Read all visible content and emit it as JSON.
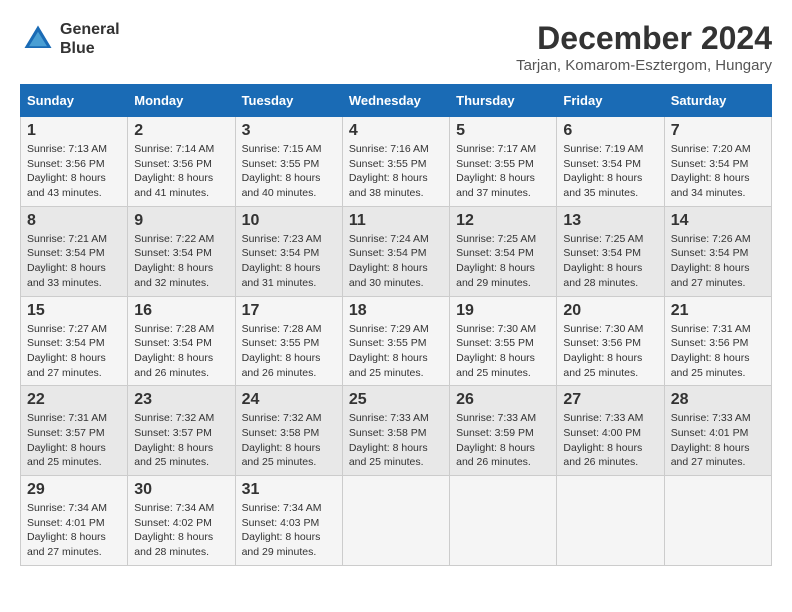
{
  "logo": {
    "line1": "General",
    "line2": "Blue"
  },
  "title": "December 2024",
  "subtitle": "Tarjan, Komarom-Esztergom, Hungary",
  "headers": [
    "Sunday",
    "Monday",
    "Tuesday",
    "Wednesday",
    "Thursday",
    "Friday",
    "Saturday"
  ],
  "weeks": [
    [
      {
        "day": "1",
        "sunrise": "Sunrise: 7:13 AM",
        "sunset": "Sunset: 3:56 PM",
        "daylight": "Daylight: 8 hours and 43 minutes."
      },
      {
        "day": "2",
        "sunrise": "Sunrise: 7:14 AM",
        "sunset": "Sunset: 3:56 PM",
        "daylight": "Daylight: 8 hours and 41 minutes."
      },
      {
        "day": "3",
        "sunrise": "Sunrise: 7:15 AM",
        "sunset": "Sunset: 3:55 PM",
        "daylight": "Daylight: 8 hours and 40 minutes."
      },
      {
        "day": "4",
        "sunrise": "Sunrise: 7:16 AM",
        "sunset": "Sunset: 3:55 PM",
        "daylight": "Daylight: 8 hours and 38 minutes."
      },
      {
        "day": "5",
        "sunrise": "Sunrise: 7:17 AM",
        "sunset": "Sunset: 3:55 PM",
        "daylight": "Daylight: 8 hours and 37 minutes."
      },
      {
        "day": "6",
        "sunrise": "Sunrise: 7:19 AM",
        "sunset": "Sunset: 3:54 PM",
        "daylight": "Daylight: 8 hours and 35 minutes."
      },
      {
        "day": "7",
        "sunrise": "Sunrise: 7:20 AM",
        "sunset": "Sunset: 3:54 PM",
        "daylight": "Daylight: 8 hours and 34 minutes."
      }
    ],
    [
      {
        "day": "8",
        "sunrise": "Sunrise: 7:21 AM",
        "sunset": "Sunset: 3:54 PM",
        "daylight": "Daylight: 8 hours and 33 minutes."
      },
      {
        "day": "9",
        "sunrise": "Sunrise: 7:22 AM",
        "sunset": "Sunset: 3:54 PM",
        "daylight": "Daylight: 8 hours and 32 minutes."
      },
      {
        "day": "10",
        "sunrise": "Sunrise: 7:23 AM",
        "sunset": "Sunset: 3:54 PM",
        "daylight": "Daylight: 8 hours and 31 minutes."
      },
      {
        "day": "11",
        "sunrise": "Sunrise: 7:24 AM",
        "sunset": "Sunset: 3:54 PM",
        "daylight": "Daylight: 8 hours and 30 minutes."
      },
      {
        "day": "12",
        "sunrise": "Sunrise: 7:25 AM",
        "sunset": "Sunset: 3:54 PM",
        "daylight": "Daylight: 8 hours and 29 minutes."
      },
      {
        "day": "13",
        "sunrise": "Sunrise: 7:25 AM",
        "sunset": "Sunset: 3:54 PM",
        "daylight": "Daylight: 8 hours and 28 minutes."
      },
      {
        "day": "14",
        "sunrise": "Sunrise: 7:26 AM",
        "sunset": "Sunset: 3:54 PM",
        "daylight": "Daylight: 8 hours and 27 minutes."
      }
    ],
    [
      {
        "day": "15",
        "sunrise": "Sunrise: 7:27 AM",
        "sunset": "Sunset: 3:54 PM",
        "daylight": "Daylight: 8 hours and 27 minutes."
      },
      {
        "day": "16",
        "sunrise": "Sunrise: 7:28 AM",
        "sunset": "Sunset: 3:54 PM",
        "daylight": "Daylight: 8 hours and 26 minutes."
      },
      {
        "day": "17",
        "sunrise": "Sunrise: 7:28 AM",
        "sunset": "Sunset: 3:55 PM",
        "daylight": "Daylight: 8 hours and 26 minutes."
      },
      {
        "day": "18",
        "sunrise": "Sunrise: 7:29 AM",
        "sunset": "Sunset: 3:55 PM",
        "daylight": "Daylight: 8 hours and 25 minutes."
      },
      {
        "day": "19",
        "sunrise": "Sunrise: 7:30 AM",
        "sunset": "Sunset: 3:55 PM",
        "daylight": "Daylight: 8 hours and 25 minutes."
      },
      {
        "day": "20",
        "sunrise": "Sunrise: 7:30 AM",
        "sunset": "Sunset: 3:56 PM",
        "daylight": "Daylight: 8 hours and 25 minutes."
      },
      {
        "day": "21",
        "sunrise": "Sunrise: 7:31 AM",
        "sunset": "Sunset: 3:56 PM",
        "daylight": "Daylight: 8 hours and 25 minutes."
      }
    ],
    [
      {
        "day": "22",
        "sunrise": "Sunrise: 7:31 AM",
        "sunset": "Sunset: 3:57 PM",
        "daylight": "Daylight: 8 hours and 25 minutes."
      },
      {
        "day": "23",
        "sunrise": "Sunrise: 7:32 AM",
        "sunset": "Sunset: 3:57 PM",
        "daylight": "Daylight: 8 hours and 25 minutes."
      },
      {
        "day": "24",
        "sunrise": "Sunrise: 7:32 AM",
        "sunset": "Sunset: 3:58 PM",
        "daylight": "Daylight: 8 hours and 25 minutes."
      },
      {
        "day": "25",
        "sunrise": "Sunrise: 7:33 AM",
        "sunset": "Sunset: 3:58 PM",
        "daylight": "Daylight: 8 hours and 25 minutes."
      },
      {
        "day": "26",
        "sunrise": "Sunrise: 7:33 AM",
        "sunset": "Sunset: 3:59 PM",
        "daylight": "Daylight: 8 hours and 26 minutes."
      },
      {
        "day": "27",
        "sunrise": "Sunrise: 7:33 AM",
        "sunset": "Sunset: 4:00 PM",
        "daylight": "Daylight: 8 hours and 26 minutes."
      },
      {
        "day": "28",
        "sunrise": "Sunrise: 7:33 AM",
        "sunset": "Sunset: 4:01 PM",
        "daylight": "Daylight: 8 hours and 27 minutes."
      }
    ],
    [
      {
        "day": "29",
        "sunrise": "Sunrise: 7:34 AM",
        "sunset": "Sunset: 4:01 PM",
        "daylight": "Daylight: 8 hours and 27 minutes."
      },
      {
        "day": "30",
        "sunrise": "Sunrise: 7:34 AM",
        "sunset": "Sunset: 4:02 PM",
        "daylight": "Daylight: 8 hours and 28 minutes."
      },
      {
        "day": "31",
        "sunrise": "Sunrise: 7:34 AM",
        "sunset": "Sunset: 4:03 PM",
        "daylight": "Daylight: 8 hours and 29 minutes."
      },
      null,
      null,
      null,
      null
    ]
  ]
}
